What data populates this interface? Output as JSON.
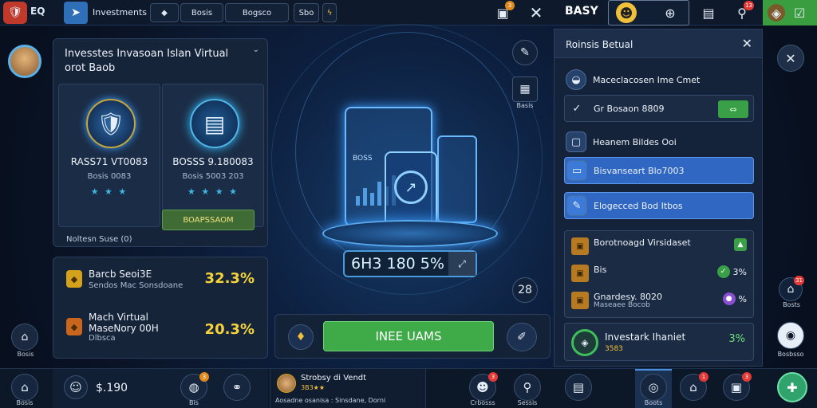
{
  "topbar": {
    "eq_label": "EQ",
    "title": "Investments",
    "buttons": [
      "Bosis",
      "Bogsco",
      "Sbo"
    ],
    "brand": "BASY",
    "badges": {
      "wallet": "3",
      "search": "13"
    }
  },
  "left_panel": {
    "title": "Invesstes Invasoan Islan Virtual orot Baob",
    "cards": [
      {
        "name": "RASS71 VT0083",
        "sub": "Bosis 0083",
        "stars": "★ ★ ★"
      },
      {
        "name": "BOSSS 9.180083",
        "sub": "Bosis 5003 203",
        "stars": "★ ★ ★ ★"
      }
    ],
    "action_button": "BOAPSSAOM",
    "footer": "Noltesn Suse (0)"
  },
  "stats_panel": {
    "rows": [
      {
        "title": "Barcb Seoi3E",
        "sub": "Sendos Mac Sonsdoane",
        "value": "32.3%"
      },
      {
        "title": "Mach Virtual MaseNory 00H",
        "sub": "Dlbsca",
        "value": "20.3%"
      }
    ]
  },
  "left_nav": {
    "home_label": "Bosis"
  },
  "center": {
    "tablet_label": "BOSS",
    "stat_pill": "6H3 180 5%",
    "icons": [
      {
        "label": "Basis"
      },
      {
        "label": "28"
      }
    ],
    "main_button": "INEE UAMS"
  },
  "right_panel": {
    "title": "Roinsis Betual",
    "items": [
      {
        "label": "Maceclacosen Ime Cmet",
        "style": "plain"
      },
      {
        "label": "Gr Bosaon 8809",
        "style": "dark"
      },
      {
        "label": "Heanem Bildes Ooi",
        "style": "plain"
      },
      {
        "label": "Bisvanseart Blo7003",
        "style": "blue"
      },
      {
        "label": "Elogecced Bod Itbos",
        "style": "blue"
      }
    ],
    "box_rows": [
      {
        "title": "Borotnoagd Virsidaset",
        "sub": "",
        "value": ""
      },
      {
        "title": "Bis",
        "sub": "",
        "value": "3%"
      },
      {
        "title": "Gnardesy. 8020",
        "sub": "Maseaee Bocob",
        "value": "%"
      }
    ],
    "investment": {
      "title": "Investark Ihaniet",
      "sub": "3583",
      "value": "3%"
    }
  },
  "bottom_bar": {
    "home_label": "Bosis",
    "value": "$.190",
    "feed": {
      "title": "Strobsy di Vendt",
      "sub": "3B3★★",
      "detail": "Aosadne osanisa : Sinsdane, Dorni"
    },
    "labels": {
      "b1": "Bis",
      "b2": "Crbosss",
      "b3": "Sessis",
      "b4": "Boots"
    },
    "badges": {
      "a": "3",
      "b": "3",
      "c": "1",
      "d": "3"
    }
  },
  "right_side": {
    "labels": [
      "Bosts",
      "Bosbsso"
    ],
    "badge": "31"
  },
  "colors": {
    "accent_blue": "#2f67c2",
    "accent_green": "#3eaa48",
    "gold": "#f3d23a"
  }
}
